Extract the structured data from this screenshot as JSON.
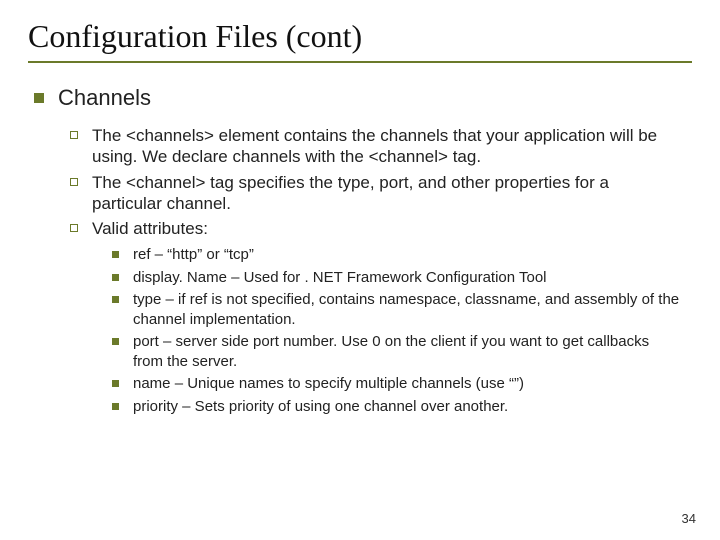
{
  "title": "Configuration Files (cont)",
  "section": "Channels",
  "points": [
    "The <channels> element contains the channels that your application will be using. We declare channels with the <channel> tag.",
    "The <channel> tag specifies the type, port, and other properties for a particular channel.",
    "Valid attributes:"
  ],
  "attrs": [
    "ref – “http” or “tcp”",
    "display. Name – Used for . NET Framework Configuration Tool",
    "type – if ref is not specified, contains namespace, classname, and assembly of the channel implementation.",
    "port – server side port number. Use 0 on the client if you want to get callbacks from the server.",
    "name – Unique names to specify multiple channels (use “”)",
    "priority – Sets priority of using one channel over another."
  ],
  "page_number": "34"
}
